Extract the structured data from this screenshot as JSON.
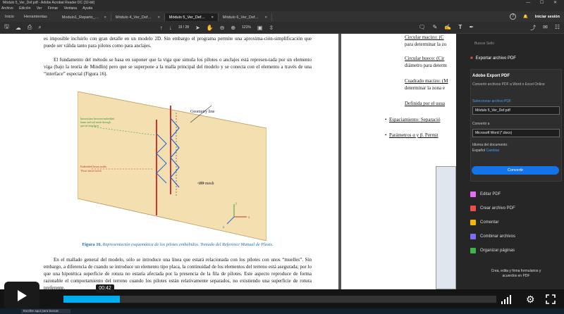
{
  "window": {
    "title": "Módulo 5_Ver_Def.pdf - Adobe Acrobat Reader DC (32-bit)",
    "controls": "—  ☐  ✕"
  },
  "menu": [
    "Archivo",
    "Edición",
    "Ver",
    "Firmar",
    "Ventana",
    "Ayuda"
  ],
  "tabs": {
    "home": "Inicio",
    "tools": "Herramientas",
    "items": [
      {
        "label": "Modulo1_Reparto_…",
        "close": "×",
        "active": false
      },
      {
        "label": "Módulo 4_Ver_Def…",
        "close": "×",
        "active": false
      },
      {
        "label": "Módulo 5_Ver_Def…",
        "close": "×",
        "active": true
      },
      {
        "label": "Módulo 6_Ver_Def…",
        "close": "×",
        "active": false
      }
    ],
    "help_icon": "?",
    "signin": "Iniciar sesión"
  },
  "toolbar": {
    "page_current": "19",
    "page_total": "/ 28",
    "zoom": "121%"
  },
  "doc": {
    "page1": {
      "para0": "es imposible incluirlo con gran detalle en un modelo 2D. Sin embargo el programa permite una aproxima-ción-simplificación que puede ser válida tanto para pilotes como para anclajes.",
      "para1": "El fundamento del método se basa en suponer que la viga que simula los pilotes o anclajes está represen-tada por un elemento viga (bajo la teoría de Mindlin) pero que se superpone a la malla principal del modelo y se conecta con el elemento a través de una “interface” especial (Figura 16).",
      "figure": {
        "geometry_line": "Geometry line",
        "mesh_label": "2D mesh",
        "left_green": [
          "Interactions between embedded",
          "beam and soil mesh through",
          "special interfaces"
        ],
        "left_red": [
          "Embedded beam nodes",
          "'Float' above mesh"
        ],
        "axis_x": "x",
        "axis_y": "y",
        "axis_z": "z"
      },
      "caption_label": "Figura 16.",
      "caption_text": " Representación esquemática de los pilotes embebidos. Tomado del Reference Manual de Plaxis.",
      "para2": "En el mallado general del modelo, sólo se introduce una línea que estará relacionada con los pilotes con unos “muelles”. Sin embargo, a diferencia de cuando se introduce un elemento tipo placa, la continuidad de los elementos del terreno está asegurada; por lo que una hipotética superficie de rotura no estaría afectada por la presencia de la fila de pilotes. Este aspecto reproduce de forma razonable el comportamiento del terreno cuando los pilotes están relativamente separados, no existiendo una superficie de rotura preferente."
    },
    "page2": {
      "l1": "Circular macizo: (C",
      "l2": "para determinar la zo",
      "l3": "Circular hueco: (Cir",
      "l4": "diámetro para determ",
      "l5": "Cuadrado macizo: (M",
      "l6": "determinar la zona e",
      "l7": "Definida por el usua",
      "b1": "Espaciamiento: Separació",
      "b2": "Parámetros α y β. Permit"
    }
  },
  "panel": {
    "search": "Buscar Sello",
    "export_head": "Exportar archivo PDF",
    "card_title": "Adobe Export PDF",
    "card_sub": "Convertir archivos PDF a Word o Excel Online",
    "select_label": "Seleccionar archivo PDF",
    "file_value": "Módulo 5_Ver_Def.pdf",
    "convert_label": "Convertir a",
    "convert_value": "Microsoft Word (*.docx)",
    "lang_label": "Idioma del documento:",
    "lang_value": "Español",
    "lang_change": "Cambiar",
    "convert_button": "Convertir",
    "tools": [
      {
        "label": "Editar PDF",
        "color": "#e56ef0"
      },
      {
        "label": "Crear archivo PDF",
        "color": "#f04b4b"
      },
      {
        "label": "Comentar",
        "color": "#f5b800"
      },
      {
        "label": "Combinar archivos",
        "color": "#7b6ef0"
      },
      {
        "label": "Organizar páginas",
        "color": "#3cb44a"
      }
    ],
    "promo": "Crea, edita y firma formularios y acuerdos en PDF"
  },
  "video": {
    "time": "00:42",
    "progress": 0.13
  },
  "taskbar": {
    "search": "Escribe aquí para buscar"
  }
}
